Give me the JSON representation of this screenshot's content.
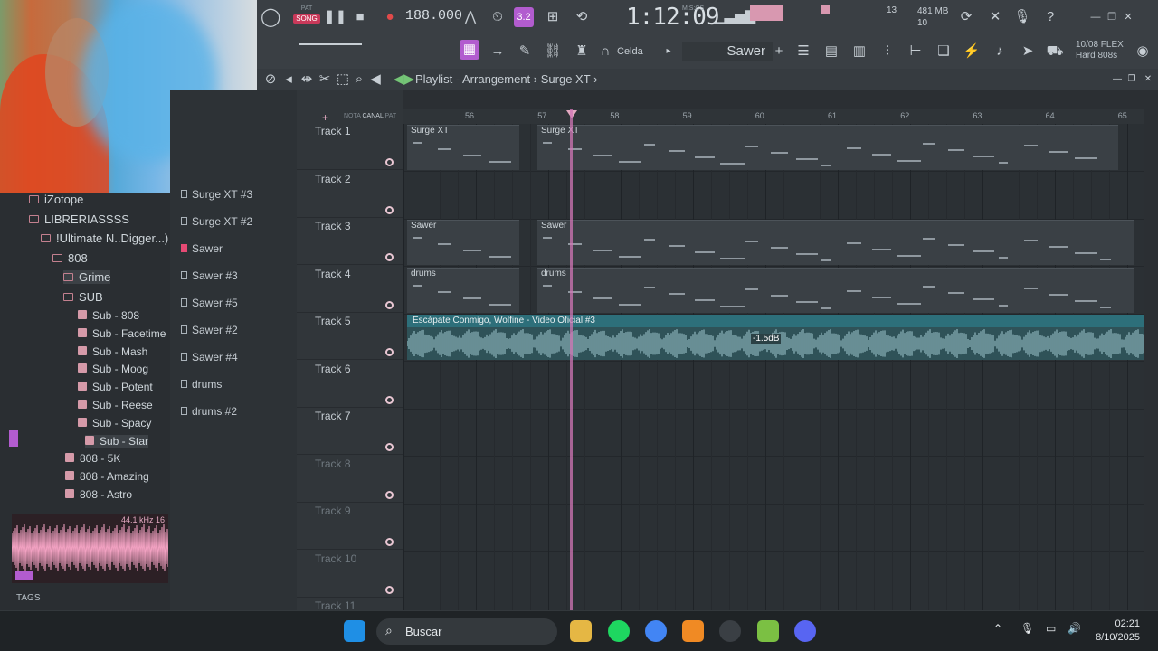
{
  "toolbar": {
    "pat_label": "PAT",
    "song_label": "SONG",
    "tempo": "188.000",
    "pattern_num": "3.2",
    "time": "1:12:09",
    "time_unit": "M:S:CS",
    "cpu_num": "13",
    "memory": "481 MB",
    "voices": "10",
    "snap": "Celda",
    "channel_selected": "Sawer",
    "flex_line1": "10/08  FLEX",
    "flex_line2": "Hard 808s"
  },
  "webcam": {
    "description_icon": "webcam-feed"
  },
  "browser": {
    "items": [
      {
        "label": "iZotope",
        "type": "folder"
      },
      {
        "label": "LIBRERIASSSS",
        "type": "folder"
      },
      {
        "label": "!Ultimate N..Digger...)",
        "type": "folder"
      },
      {
        "label": "808",
        "type": "folder"
      },
      {
        "label": "Grime",
        "type": "folder"
      },
      {
        "label": "SUB",
        "type": "folder"
      },
      {
        "label": "Sub - 808",
        "type": "file"
      },
      {
        "label": "Sub - Facetime",
        "type": "file"
      },
      {
        "label": "Sub - Mash",
        "type": "file"
      },
      {
        "label": "Sub - Moog",
        "type": "file"
      },
      {
        "label": "Sub - Potent",
        "type": "file"
      },
      {
        "label": "Sub - Reese",
        "type": "file"
      },
      {
        "label": "Sub - Spacy",
        "type": "file"
      },
      {
        "label": "Sub - Star",
        "type": "file"
      },
      {
        "label": "808 - 5K",
        "type": "file"
      },
      {
        "label": "808 - Amazing",
        "type": "file"
      },
      {
        "label": "808 - Astro",
        "type": "file"
      }
    ],
    "preview_info": "44.1 kHz 16",
    "tags_label": "TAGS"
  },
  "channels": {
    "items": [
      "Surge XT #3",
      "Surge XT #2",
      "Sawer",
      "Sawer #3",
      "Sawer #5",
      "Sawer #2",
      "Sawer #4",
      "drums",
      "drums #2"
    ]
  },
  "playlist": {
    "title": "Playlist - Arrangement",
    "pattern": "Surge XT",
    "header_nota": "NOTA",
    "header_canal": "CANAL",
    "header_pat": "PAT",
    "ruler": [
      "56",
      "57",
      "58",
      "59",
      "60",
      "61",
      "62",
      "63",
      "64",
      "65"
    ],
    "tracks": [
      "Track 1",
      "Track 2",
      "Track 3",
      "Track 4",
      "Track 5",
      "Track 6",
      "Track 7",
      "Track 8",
      "Track 9",
      "Track 10",
      "Track 11"
    ],
    "clips": {
      "surge_a": "Surge XT",
      "surge_b": "Surge XT",
      "sawer_a": "Sawer",
      "sawer_b": "Sawer",
      "drums_a": "drums",
      "drums_b": "drums",
      "audio": "Escápate Conmigo, Wolfine - Video Oficial #3",
      "audio_gain": "-1.5dB"
    }
  },
  "taskbar": {
    "search_label": "Buscar",
    "time": "02:21",
    "date": "8/10/2025"
  },
  "colors": {
    "accent": "#b25ccf",
    "playhead": "#d276b5",
    "audio_clip": "#2d6f7a",
    "preview_wave": "#f0a0c0"
  }
}
